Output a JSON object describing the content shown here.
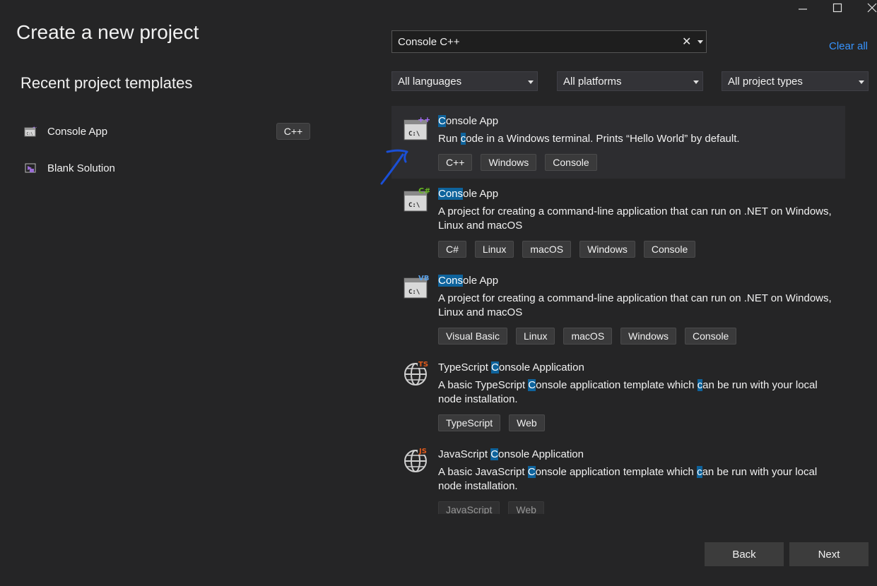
{
  "page_title": "Create a new project",
  "recent": {
    "heading": "Recent project templates",
    "items": [
      {
        "label": "Console App",
        "language": "C++"
      },
      {
        "label": "Blank Solution"
      }
    ]
  },
  "search": {
    "value": "Console C++"
  },
  "clear_all_label": "Clear all",
  "filters": {
    "language": "All languages",
    "platform": "All platforms",
    "project_type": "All project types"
  },
  "templates": [
    {
      "name_prefix": "",
      "name_hl": "C",
      "name_rest": "onsole App",
      "desc_parts": [
        "Run ",
        "c",
        "ode in a Windows terminal. Prints “Hello World” by default."
      ],
      "tags": [
        "C++",
        "Windows",
        "Console"
      ],
      "icon": "cpp-console-icon",
      "badge": "++"
    },
    {
      "name_prefix": "",
      "name_hl": "Cons",
      "name_rest": "ole App",
      "desc": "A project for creating a command-line application that can run on .NET on Windows, Linux and macOS",
      "tags": [
        "C#",
        "Linux",
        "macOS",
        "Windows",
        "Console"
      ],
      "icon": "csharp-console-icon",
      "badge": "C#"
    },
    {
      "name_prefix": "",
      "name_hl": "Cons",
      "name_rest": "ole App",
      "desc": "A project for creating a command-line application that can run on .NET on Windows, Linux and macOS",
      "tags": [
        "Visual Basic",
        "Linux",
        "macOS",
        "Windows",
        "Console"
      ],
      "icon": "vb-console-icon",
      "badge": "VB"
    },
    {
      "name_prefix": "TypeScript ",
      "name_hl": "C",
      "name_rest": "onsole Application",
      "desc_parts": [
        "A basic TypeScript ",
        "C",
        "onsole application template which ",
        "c",
        "an be run with your local node installation."
      ],
      "tags": [
        "TypeScript",
        "Web"
      ],
      "icon": "typescript-globe-icon",
      "badge": "TS"
    },
    {
      "name_prefix": "JavaScript ",
      "name_hl": "C",
      "name_rest": "onsole Application",
      "desc_parts": [
        "A basic JavaScript ",
        "C",
        "onsole application template which ",
        "c",
        "an be run with your local node installation."
      ],
      "tags": [
        "JavaScript",
        "Web"
      ],
      "icon": "javascript-globe-icon",
      "badge": "JS"
    }
  ],
  "buttons": {
    "back": "Back",
    "next": "Next"
  },
  "colors": {
    "background": "#252526",
    "highlight": "#0e639c",
    "link": "#3794ff",
    "annotation_arrow": "#1a4fd6",
    "ts_badge": "#e05a1c",
    "cpp_badge": "#a970ff",
    "cs_badge": "#68b723",
    "vb_badge": "#5aa0e6"
  }
}
